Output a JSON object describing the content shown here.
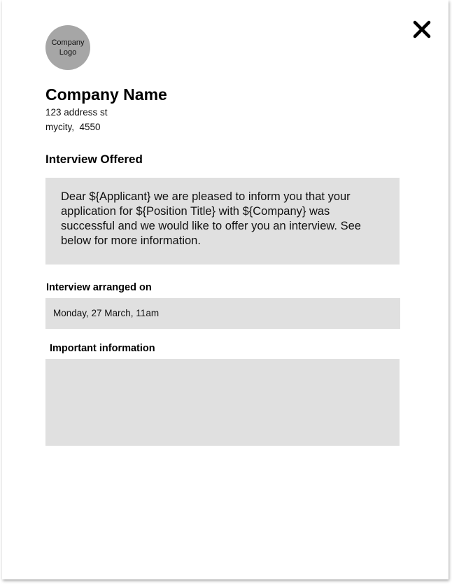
{
  "header": {
    "logo_text": "Company Logo",
    "company_name": "Company Name",
    "address_line1": "123 address st",
    "address_line2": "mycity,  4550"
  },
  "close_icon": "close-icon",
  "main": {
    "heading": "Interview Offered",
    "message": "Dear ${Applicant} we are pleased to inform you that your application for ${Position Title} with ${Company} was successful and we would like to offer you an interview. See below for more information.",
    "arranged_label": "Interview arranged on",
    "arranged_value": "Monday, 27 March, 11am",
    "important_label": "Important information",
    "important_value": ""
  },
  "colors": {
    "field_background": "#e0e0e0",
    "logo_background": "#a6a6a6",
    "text": "#000000"
  }
}
